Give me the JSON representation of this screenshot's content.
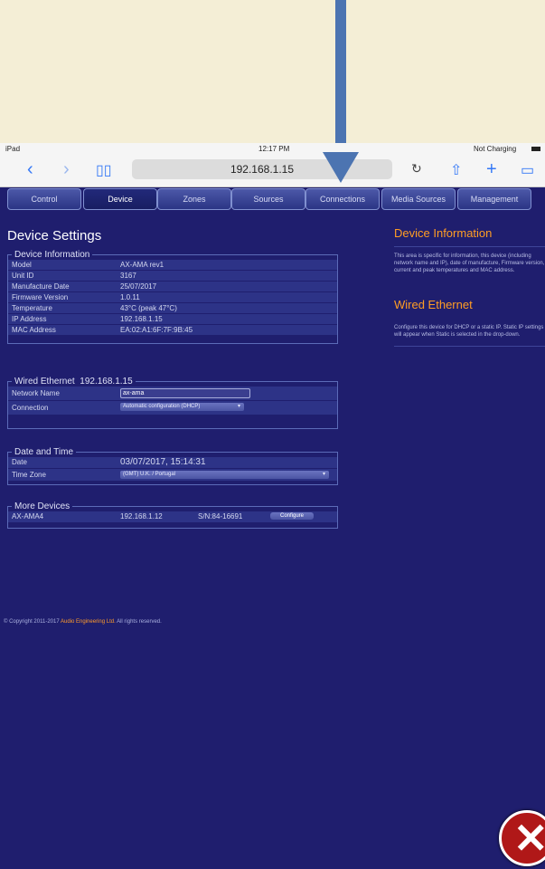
{
  "statusbar": {
    "device": "iPad",
    "time": "12:17 PM",
    "battery": "Not Charging"
  },
  "browser": {
    "url": "192.168.1.15"
  },
  "tabs": [
    "Control",
    "Device",
    "Zones",
    "Sources",
    "Connections",
    "Media Sources",
    "Management"
  ],
  "active_tab": "Device",
  "page_title": "Device Settings",
  "device_info": {
    "legend": "Device Information",
    "rows": [
      {
        "label": "Model",
        "value": "AX-AMA rev1"
      },
      {
        "label": "Unit ID",
        "value": "3167"
      },
      {
        "label": "Manufacture Date",
        "value": "25/07/2017"
      },
      {
        "label": "Firmware Version",
        "value": "1.0.11"
      },
      {
        "label": "Temperature",
        "value": "43°C (peak 47°C)"
      },
      {
        "label": "IP Address",
        "value": "192.168.1.15"
      },
      {
        "label": "MAC Address",
        "value": "EA:02:A1:6F:7F:9B:45"
      }
    ]
  },
  "wired": {
    "legend_label": "Wired Ethernet",
    "legend_ip": "192.168.1.15",
    "network_name_label": "Network Name",
    "network_name_value": "ax-ama",
    "connection_label": "Connection",
    "connection_value": "Automatic configuration (DHCP)"
  },
  "date_time": {
    "legend": "Date and Time",
    "date_label": "Date",
    "date_value": "03/07/2017, 15:14:31",
    "tz_label": "Time Zone",
    "tz_value": "(GMT) U.K. / Portugal"
  },
  "more_devices": {
    "legend": "More Devices",
    "name": "AX-AMA4",
    "ip": "192.168.1.12",
    "serial": "S/N:84-16691",
    "button": "Configure"
  },
  "copyright": {
    "prefix": "© Copyright 2011-2017",
    "company": "Audio Engineering Ltd.",
    "suffix": "All rights reserved."
  },
  "right_panel": {
    "device_info_title": "Device Information",
    "device_info_text": "This area is specific for information, this device (including network name and IP), date of manufacture, Firmware version, current and peak temperatures and MAC address.",
    "wired_title": "Wired Ethernet",
    "wired_text": "Configure this device for DHCP or a static IP. Static IP settings will appear when Static is selected in the drop-down."
  }
}
